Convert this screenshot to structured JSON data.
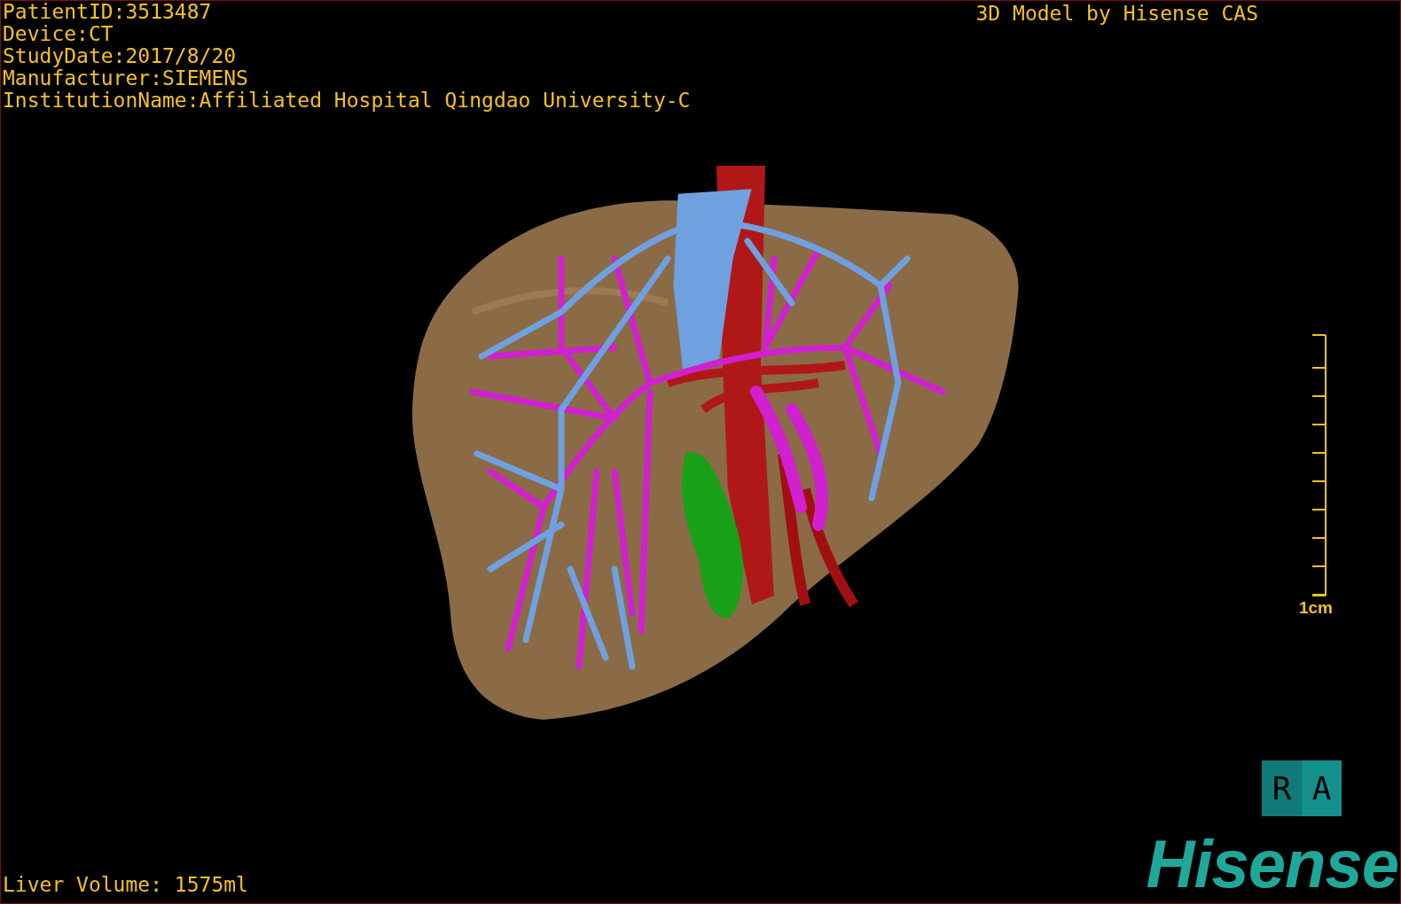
{
  "study_info": [
    "PatientID:3513487",
    "Device:CT",
    "StudyDate:2017/8/20",
    "Manufacturer:SIEMENS",
    "InstitutionName:Affiliated Hospital Qingdao University-C"
  ],
  "title": "3D Model by Hisense CAS",
  "scale_bar": {
    "label": "1cm"
  },
  "liver_volume": "Liver Volume: 1575ml",
  "orientation_cube": {
    "left_face": "R",
    "front_face": "A"
  },
  "logo": "Hisense"
}
